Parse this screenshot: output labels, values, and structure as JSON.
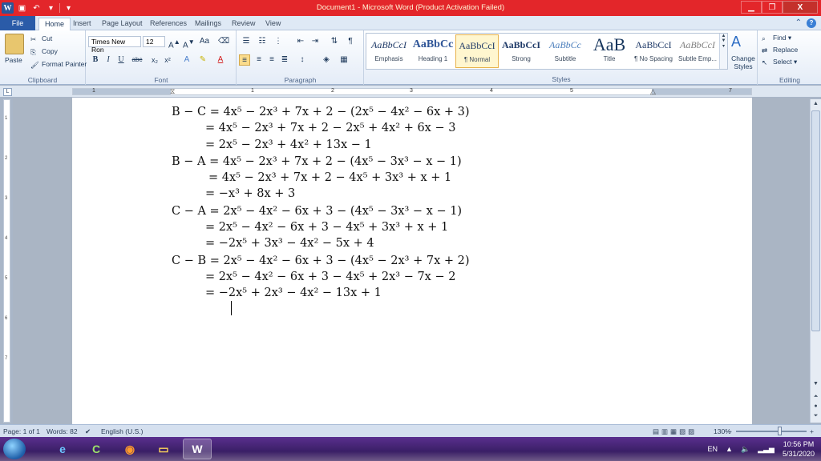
{
  "window": {
    "title": "Document1 - Microsoft Word (Product Activation Failed)",
    "controls": {
      "minimize": "▁",
      "restore": "❐",
      "close": "X"
    }
  },
  "tabs": [
    "File",
    "Home",
    "Insert",
    "Page Layout",
    "References",
    "Mailings",
    "Review",
    "View"
  ],
  "ribbon": {
    "clipboard": {
      "group": "Clipboard",
      "paste": "Paste",
      "cut": "Cut",
      "copy": "Copy",
      "format_painter": "Format Painter"
    },
    "font": {
      "group": "Font",
      "name": "Times New Ron",
      "size": "12",
      "bold": "B",
      "italic": "I",
      "underline": "U",
      "strike": "abc",
      "subscript": "x₂",
      "superscript": "x²"
    },
    "paragraph": {
      "group": "Paragraph",
      "pilcrow": "¶"
    },
    "styles": {
      "group": "Styles",
      "items": [
        {
          "preview": "AaBbCcI",
          "label": "Emphasis"
        },
        {
          "preview": "AaBbCc",
          "label": "Heading 1"
        },
        {
          "preview": "AaBbCcI",
          "label": "¶ Normal"
        },
        {
          "preview": "AaBbCcI",
          "label": "Strong"
        },
        {
          "preview": "AaBbCc",
          "label": "Subtitle"
        },
        {
          "preview": "AaB",
          "label": "Title"
        },
        {
          "preview": "AaBbCcI",
          "label": "¶ No Spacing"
        },
        {
          "preview": "AaBbCcI",
          "label": "Subtle Emp..."
        }
      ],
      "change_styles": "Change Styles"
    },
    "editing": {
      "group": "Editing",
      "find": "Find",
      "replace": "Replace",
      "select": "Select"
    }
  },
  "ruler": {
    "labels": [
      "1",
      "1",
      "2",
      "3",
      "4",
      "5",
      "7"
    ],
    "tab_selector": "L"
  },
  "vruler": {
    "labels": [
      "1",
      "2",
      "3",
      "4",
      "5",
      "6",
      "7"
    ]
  },
  "document": {
    "lines": [
      "B − C = 4x⁵ − 2x³ + 7x + 2 − (2x⁵ − 4x² − 6x + 3)",
      "= 4x⁵ − 2x³ + 7x + 2 − 2x⁵ + 4x² + 6x − 3",
      "= 2x⁵ − 2x³ + 4x² + 13x − 1",
      "B − A = 4x⁵ − 2x³ + 7x + 2 − (4x⁵ − 3x³ − x − 1)",
      "= 4x⁵ − 2x³ + 7x + 2 − 4x⁵ + 3x³ + x + 1",
      "= −x³ + 8x + 3",
      "C − A = 2x⁵ − 4x² − 6x + 3 − (4x⁵ − 3x³ − x − 1)",
      "= 2x⁵ − 4x² − 6x + 3 − 4x⁵ + 3x³ + x + 1",
      "= −2x⁵ + 3x³ − 4x² − 5x + 4",
      "C − B = 2x⁵ − 4x² − 6x + 3 − (4x⁵ − 2x³ + 7x + 2)",
      "= 2x⁵ − 4x² − 6x + 3 − 4x⁵ + 2x³ − 7x − 2",
      "= −2x⁵ + 2x³ − 4x² − 13x + 1"
    ]
  },
  "status": {
    "page": "Page: 1 of 1",
    "words": "Words: 82",
    "language": "English (U.S.)",
    "zoom": "130%",
    "zoom_minus": "−",
    "zoom_plus": "+"
  },
  "taskbar": {
    "apps": [
      "internet-explorer",
      "c-cleaner",
      "firefox",
      "file-explorer",
      "word"
    ],
    "lang": "EN",
    "time": "10:56 PM",
    "date": "5/31/2020"
  },
  "colors": {
    "title_bar": "#e3262a",
    "file_tab": "#2a5ba8",
    "taskbar": "#3a1f66"
  }
}
